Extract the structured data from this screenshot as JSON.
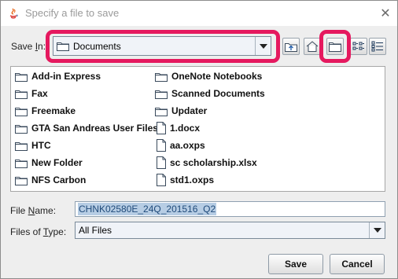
{
  "window": {
    "title": "Specify a file to save",
    "close_symbol": "✕"
  },
  "save_in": {
    "label_pre": "Save ",
    "label_mnemonic": "I",
    "label_post": "n:",
    "value": "Documents",
    "value_icon": "folder-icon"
  },
  "toolbar": {
    "buttons": [
      {
        "name": "up-one-level-button",
        "icon": "up-folder-icon"
      },
      {
        "name": "home-button",
        "icon": "home-icon"
      },
      {
        "name": "new-folder-button",
        "icon": "new-folder-icon"
      },
      {
        "name": "list-view-button",
        "icon": "list-view-icon"
      },
      {
        "name": "details-view-button",
        "icon": "details-view-icon"
      }
    ]
  },
  "highlight_color": "#e5195f",
  "files": {
    "column1": [
      {
        "name": "Add-in Express",
        "type": "folder"
      },
      {
        "name": "Fax",
        "type": "folder"
      },
      {
        "name": "Freemake",
        "type": "folder"
      },
      {
        "name": "GTA San Andreas User Files",
        "type": "folder"
      },
      {
        "name": "HTC",
        "type": "folder"
      },
      {
        "name": "New Folder",
        "type": "folder"
      },
      {
        "name": "NFS Carbon",
        "type": "folder"
      }
    ],
    "column2": [
      {
        "name": "OneNote Notebooks",
        "type": "folder"
      },
      {
        "name": "Scanned Documents",
        "type": "folder"
      },
      {
        "name": "Updater",
        "type": "folder"
      },
      {
        "name": "1.docx",
        "type": "file"
      },
      {
        "name": "aa.oxps",
        "type": "file"
      },
      {
        "name": "sc scholarship.xlsx",
        "type": "file"
      },
      {
        "name": "std1.oxps",
        "type": "file"
      }
    ]
  },
  "file_name": {
    "label_pre": "File ",
    "label_mnemonic": "N",
    "label_post": "ame:",
    "value": "CHNK02580E_24Q_201516_Q2"
  },
  "files_of_type": {
    "label_pre": "Files of ",
    "label_mnemonic": "T",
    "label_post": "ype:",
    "value": "All Files"
  },
  "buttons": {
    "save": "Save",
    "cancel": "Cancel"
  }
}
